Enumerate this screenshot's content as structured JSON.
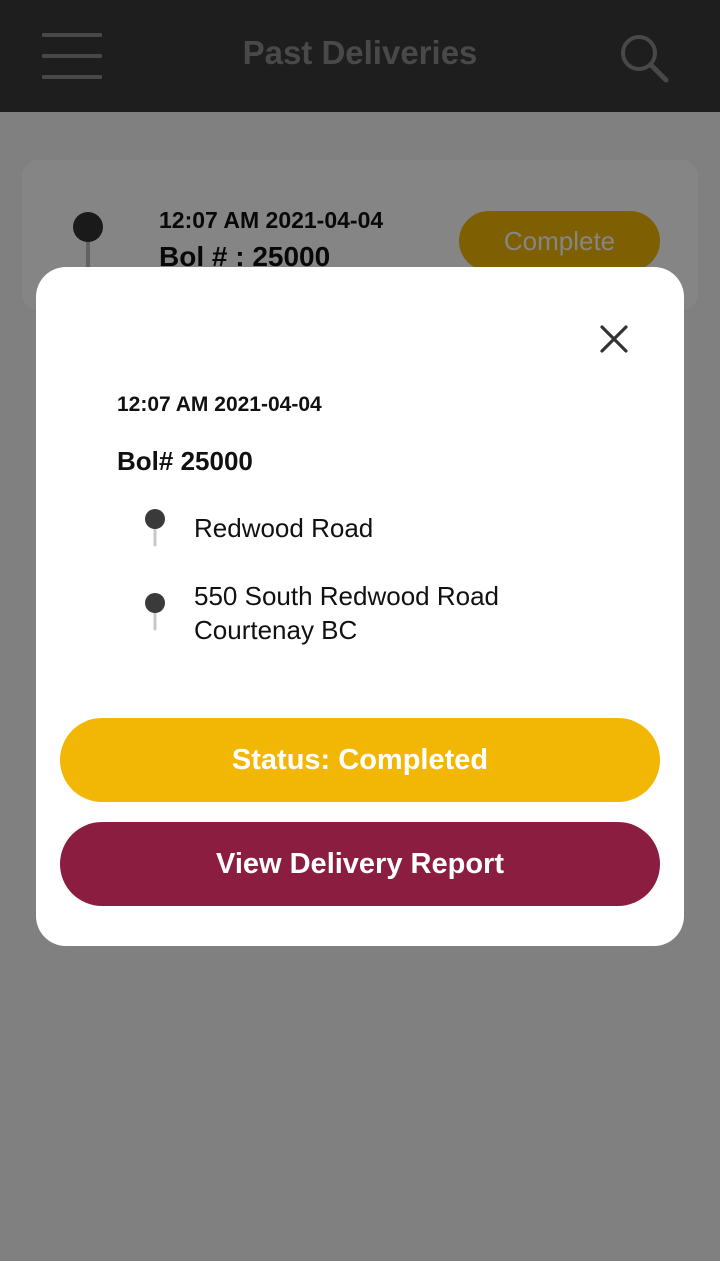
{
  "colors": {
    "app_bar": "#3a3a3a",
    "accent_yellow": "#f2b705",
    "accent_maroon": "#8b1d41",
    "scrim": "rgba(0,0,0,0.48)"
  },
  "header": {
    "title": "Past Deliveries",
    "menu_icon": "hamburger-menu-icon",
    "search_icon": "search-icon"
  },
  "delivery_card": {
    "time": "12:07 AM 2021-04-04",
    "bol": "Bol # : 25000",
    "status_badge": "Complete",
    "pin_icon": "map-pin-icon"
  },
  "modal": {
    "close_icon": "close-icon",
    "time": "12:07 AM 2021-04-04",
    "bol": "Bol# 25000",
    "addresses": [
      {
        "icon": "map-pin-icon",
        "line1": "Redwood Road",
        "line2": ""
      },
      {
        "icon": "map-pin-icon",
        "line1": "550 South Redwood Road",
        "line2": "Courtenay BC"
      }
    ],
    "status_button": "Status: Completed",
    "report_button": "View Delivery Report"
  }
}
